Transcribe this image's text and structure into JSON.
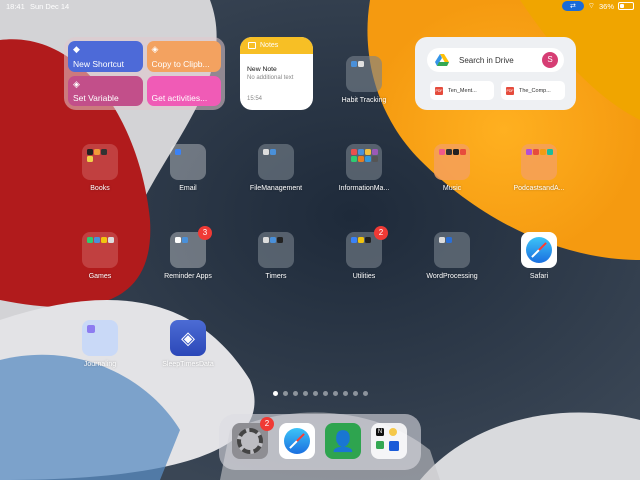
{
  "status_bar": {
    "time": "18:41",
    "date": "Sun Dec 14",
    "battery_percent": "36%",
    "battery_level": 0.36,
    "screen_cast_icon": "screen-mirroring-icon",
    "wifi_icon": "wifi-icon"
  },
  "shortcuts_widget": {
    "items": [
      {
        "label": "New Shortcut",
        "icon": "shortcut-icon",
        "color": "#4d6ad8"
      },
      {
        "label": "Copy to Clipb...",
        "icon": "layers-icon",
        "color": "#f3a260"
      },
      {
        "label": "Set Variable",
        "icon": "layers-icon",
        "color": "#c24f8a"
      },
      {
        "label": "Get activities...",
        "icon": "none",
        "color": "#f05bb6"
      }
    ]
  },
  "notes_widget": {
    "header": "Notes",
    "note_title": "New Note",
    "note_subtitle": "No additional text",
    "note_time": "15:54"
  },
  "drive_widget": {
    "search_label": "Search in Drive",
    "avatar_letter": "S",
    "files": [
      {
        "name": "Ten_Ment...",
        "type": "PDF"
      },
      {
        "name": "The_Comp...",
        "type": "PDF"
      }
    ]
  },
  "apps": {
    "habit_tracking": "Habit Tracking",
    "books": "Books",
    "email": "Email",
    "file_management": "FileManagement",
    "information_ma": "InformationMa...",
    "music": "Music",
    "podcasts": "PodcastsandA...",
    "games": "Games",
    "reminder_apps": "Reminder Apps",
    "reminder_badge": "3",
    "timers": "Timers",
    "utilities": "Utilities",
    "utilities_badge": "2",
    "word_processing": "WordProcessing",
    "safari": "Safari",
    "journaling": "Journaling",
    "sleep_times": "SleepTimesData"
  },
  "page_dots": {
    "count": 10,
    "active_index": 0
  },
  "dock": {
    "settings_badge": "2",
    "contacts_glyph": "👤",
    "folder_glyph": "N"
  },
  "colors": {
    "badge_red": "#f03a35",
    "notes_yellow": "#f7bf25",
    "wallpaper_orange": "#f9a51b",
    "wallpaper_red": "#c8201e"
  }
}
